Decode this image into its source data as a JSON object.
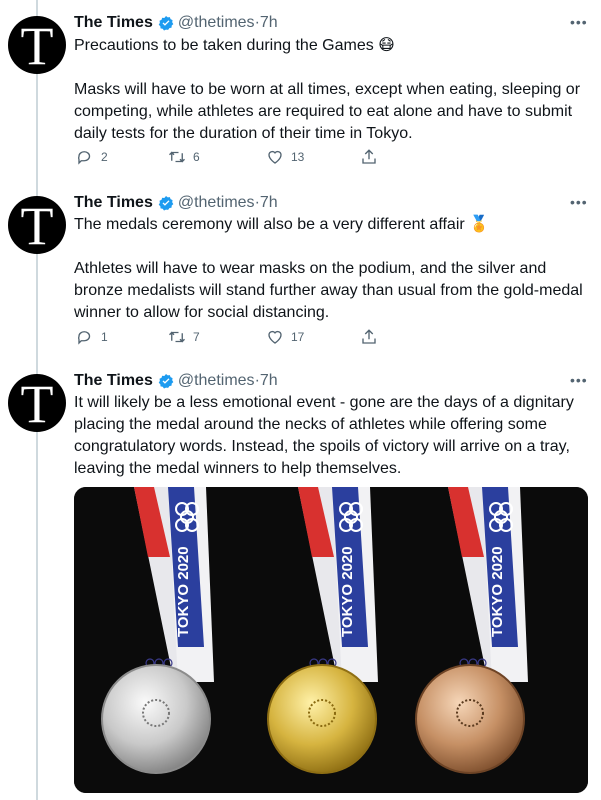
{
  "tweets": [
    {
      "author": "The Times",
      "handle": "@thetimes",
      "separator": "·",
      "time": "7h",
      "avatar_letter": "T",
      "paragraphs": [
        "Precautions to be taken during the Games 😷",
        "Masks will have to be worn at all times, except when eating, sleeping or competing, while athletes are required to eat alone and have to submit daily tests for the duration of their time in Tokyo."
      ],
      "replies": "2",
      "retweets": "6",
      "likes": "13"
    },
    {
      "author": "The Times",
      "handle": "@thetimes",
      "separator": "·",
      "time": "7h",
      "avatar_letter": "T",
      "paragraphs": [
        "The medals ceremony will also be a very different affair 🏅",
        "Athletes will have to wear masks on the podium, and the silver and bronze medalists will stand further away than usual from the gold-medal winner to allow for social distancing."
      ],
      "replies": "1",
      "retweets": "7",
      "likes": "17"
    },
    {
      "author": "The Times",
      "handle": "@thetimes",
      "separator": "·",
      "time": "7h",
      "avatar_letter": "T",
      "paragraphs": [
        "It will likely be a less emotional event - gone are the days of a dignitary placing the medal around the necks of athletes while offering some congratulatory words. Instead, the spoils of victory will arrive on a tray, leaving the medal winners to help themselves."
      ]
    }
  ],
  "media": {
    "ribbon_text": "TOKYO 2020",
    "medals": [
      "silver",
      "gold",
      "bronze"
    ]
  },
  "colors": {
    "verified": "#1d9bf0",
    "text": "#0f1419",
    "secondary": "#536471",
    "ribbon_blue": "#2b3f9e",
    "ribbon_red": "#d8312f"
  },
  "icons": [
    "more-icon",
    "verified-badge-icon",
    "reply-icon",
    "retweet-icon",
    "like-icon",
    "share-icon"
  ]
}
